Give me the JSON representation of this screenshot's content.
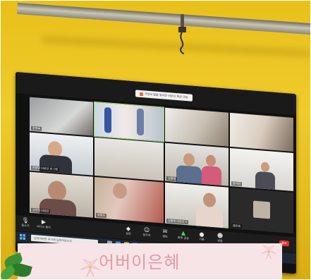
{
  "zoom_title": "가정의 달을 맞이한 어르신 화상 모임",
  "participants": [
    {
      "name": "장현숙"
    },
    {
      "name": ""
    },
    {
      "name": ""
    },
    {
      "name": ""
    },
    {
      "name": "한형만 어르신 외 1명"
    },
    {
      "name": ""
    },
    {
      "name": "김형래"
    },
    {
      "name": "강나린"
    },
    {
      "name": "김정희 어르신"
    },
    {
      "name": "박태수"
    },
    {
      "name": "김형래 어르신 1"
    },
    {
      "name": "윤인숙"
    }
  ],
  "toolbar": {
    "mute": "음소거",
    "video": "비디오 중지",
    "security": "보안",
    "participants": "참가자",
    "chat": "채팅",
    "share": "화면 공유",
    "record": "기록",
    "reactions": "반응",
    "end": "종료"
  },
  "taskbar": {
    "search_placeholder": "검색하려면 여기에 입력하십시오"
  },
  "banner": {
    "text": "어버이은혜"
  },
  "colors": {
    "wall": "#e9c21c",
    "banner": "#f7e4e6",
    "banner_text": "#e39aa6",
    "end_button": "#e0302c"
  }
}
